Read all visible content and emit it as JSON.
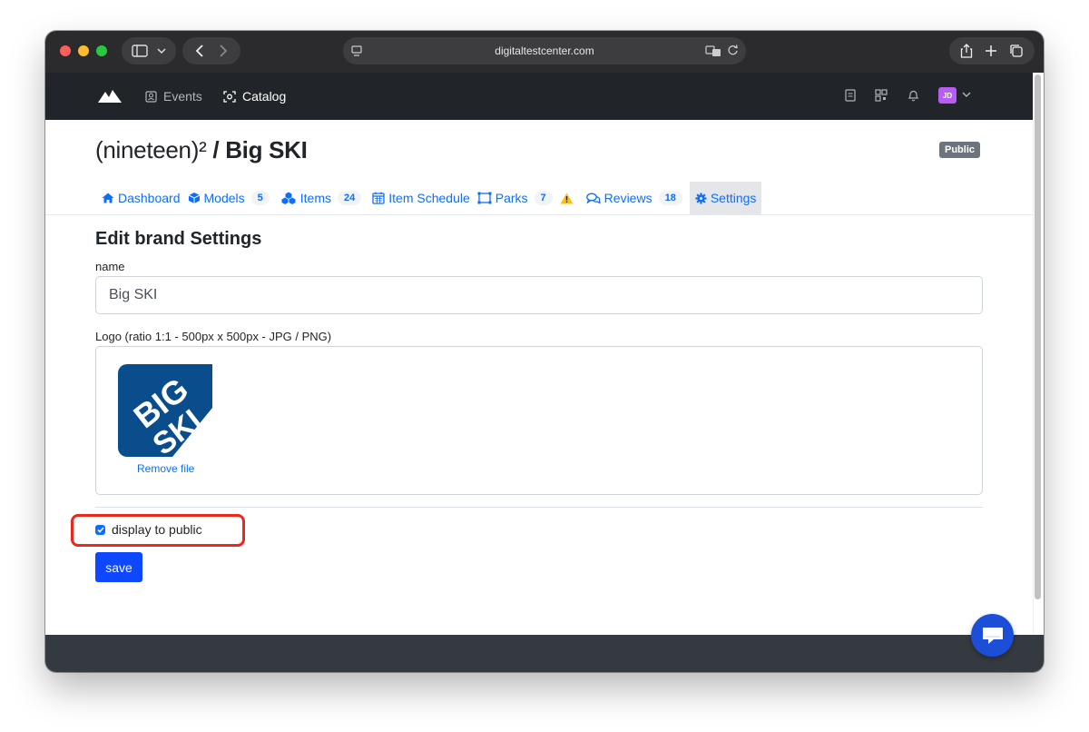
{
  "browser": {
    "url": "digitaltestcenter.com"
  },
  "app": {
    "nav": {
      "events_label": "Events",
      "catalog_label": "Catalog"
    },
    "user_initials": "JD"
  },
  "page": {
    "title_prefix": "(nineteen)² ",
    "title_bold": "/ Big SKI",
    "badge": "Public"
  },
  "tabs": [
    {
      "label": "Dashboard",
      "icon": "home-icon"
    },
    {
      "label": "Models",
      "count": "5",
      "icon": "cube-icon"
    },
    {
      "label": "Items",
      "count": "24",
      "icon": "cubes-icon"
    },
    {
      "label": "Item Schedule",
      "icon": "calendar-icon"
    },
    {
      "label": "Parks",
      "count": "7",
      "icon": "park-icon",
      "warning": true
    },
    {
      "label": "Reviews",
      "count": "18",
      "icon": "comments-icon"
    },
    {
      "label": "Settings",
      "icon": "gear-icon",
      "active": true
    }
  ],
  "form": {
    "section_title": "Edit brand Settings",
    "name_label": "name",
    "name_value": "Big SKI",
    "logo_label": "Logo (ratio 1:1 - 500px x 500px - JPG / PNG)",
    "logo_text_1": "BIG",
    "logo_text_2": "SKI",
    "remove_file_label": "Remove file",
    "display_public_label": "display to public",
    "display_public_checked": true,
    "save_label": "save"
  },
  "colors": {
    "accent": "#0d6efd",
    "save_button": "#0d47ff",
    "highlight": "#e8291c",
    "header": "#212529",
    "logo_blue": "#0a4d8c"
  }
}
